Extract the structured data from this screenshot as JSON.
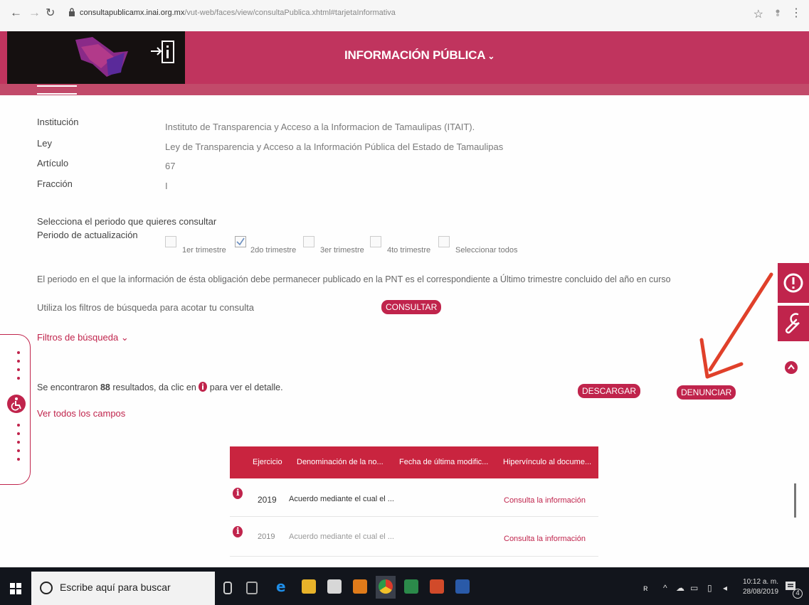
{
  "browser": {
    "url_host": "consultapublicamx.inai.org.mx",
    "url_path": "/vut-web/faces/view/consultaPublica.xhtml#tarjetaInformativa"
  },
  "header": {
    "title": "INFORMACIÓN PÚBLICA"
  },
  "info": {
    "institucion_label": "Institución",
    "institucion_value": "Instituto de Transparencia y Acceso a la Informacion de Tamaulipas (ITAIT).",
    "ley_label": "Ley",
    "ley_value": "Ley de Transparencia y Acceso a la Información Pública del Estado de Tamaulipas",
    "articulo_label": "Artículo",
    "articulo_value": "67",
    "fraccion_label": "Fracción",
    "fraccion_value": "I"
  },
  "periodo": {
    "prompt": "Selecciona el periodo que quieres consultar",
    "label": "Periodo de actualización",
    "options": [
      "1er trimestre",
      "2do trimestre",
      "3er trimestre",
      "4to trimestre",
      "Seleccionar todos"
    ],
    "checked_index": 1
  },
  "note": "El periodo en el que la información de ésta obligación debe permanecer publicado en la PNT es el correspondiente a Último trimestre concluido del año en curso",
  "filters": {
    "hint": "Utiliza los filtros de búsqueda para acotar tu consulta",
    "consultar_label": "CONSULTAR",
    "toggle_label": "Filtros de búsqueda"
  },
  "results": {
    "prefix": "Se encontraron",
    "count": "88",
    "middle": "resultados, da clic en",
    "suffix": "para ver el detalle.",
    "ver_todos": "Ver todos los campos",
    "descargar_label": "DESCARGAR",
    "denunciar_label": "DENUNCIAR"
  },
  "table": {
    "headers": [
      "Ejercicio",
      "Denominación de la no...",
      "Fecha de última modific...",
      "Hipervínculo al docume..."
    ],
    "rows": [
      {
        "ejercicio": "2019",
        "denominacion": "Acuerdo mediante el cual el ...",
        "link": "Consulta la información"
      },
      {
        "ejercicio": "2019",
        "denominacion": "Acuerdo mediante el cual el ...",
        "link": "Consulta la información"
      }
    ]
  },
  "taskbar": {
    "search_placeholder": "Escribe aquí para buscar",
    "time": "10:12 a. m.",
    "date": "28/08/2019",
    "notifications": "4"
  },
  "colors": {
    "brand": "#c0244c",
    "header": "#c0345e",
    "annotation_arrow": "#e0402a"
  }
}
